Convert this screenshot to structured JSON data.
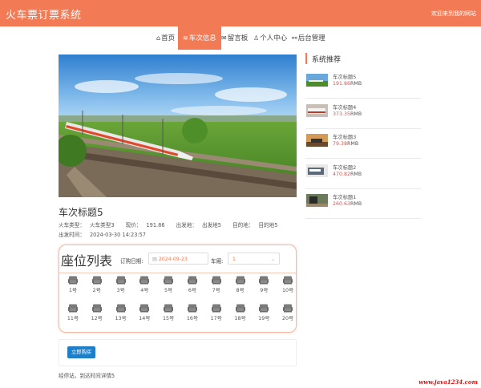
{
  "header": {
    "brand": "火车票订票系统",
    "welcome": "欢迎来到我的网站"
  },
  "nav": {
    "items": [
      {
        "label": "首页",
        "icon": "home-icon",
        "glyph": "⌂"
      },
      {
        "label": "车次信息",
        "icon": "train-icon",
        "glyph": "≋",
        "active": true
      },
      {
        "label": "留言板",
        "icon": "message-icon",
        "glyph": "✉"
      },
      {
        "label": "个人中心",
        "icon": "user-icon",
        "glyph": "♙"
      },
      {
        "label": "后台管理",
        "icon": "link-icon",
        "glyph": "⚯"
      }
    ]
  },
  "detail": {
    "title": "车次标题5",
    "meta1": [
      {
        "label": "火车类型：",
        "value": "火车类型3"
      },
      {
        "label": "现价：",
        "value": "191.86"
      },
      {
        "label": "出发地：",
        "value": "出发地5"
      },
      {
        "label": "目的地：",
        "value": "目的地5"
      }
    ],
    "meta2": [
      {
        "label": "出发时间：",
        "value": "2024-03-30 14:23:57"
      }
    ]
  },
  "seats": {
    "title": "座位列表",
    "date_label": "订购日期:",
    "date_value": "2024-09-23",
    "car_label": "车厢:",
    "car_value": "1",
    "items": [
      "1号",
      "2号",
      "3号",
      "4号",
      "5号",
      "6号",
      "7号",
      "8号",
      "9号",
      "10号",
      "11号",
      "12号",
      "13号",
      "14号",
      "15号",
      "16号",
      "17号",
      "18号",
      "19号",
      "20号"
    ]
  },
  "buy": {
    "label": "立即购买"
  },
  "note": "经停站，到达时间详情5",
  "sidebar": {
    "title": "系统推荐",
    "items": [
      {
        "title": "车次标题5",
        "price": "191.86",
        "unit": "RMB"
      },
      {
        "title": "车次标题4",
        "price": "373.35",
        "unit": "RMB"
      },
      {
        "title": "车次标题3",
        "price": "79.38",
        "unit": "RMB"
      },
      {
        "title": "车次标题2",
        "price": "470.82",
        "unit": "RMB"
      },
      {
        "title": "车次标题1",
        "price": "260.63",
        "unit": "RMB"
      }
    ]
  },
  "watermark": "www.java1234.com",
  "colors": {
    "accent": "#f27a55",
    "button": "#1e7ec8",
    "price": "#d9534f"
  }
}
